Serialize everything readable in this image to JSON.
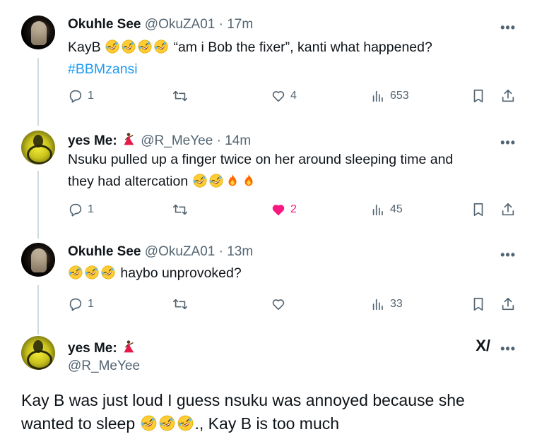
{
  "tweets": [
    {
      "name": "Okuhle See",
      "handle": "@OkuZA01",
      "time": "17m",
      "text_prefix": "KayB",
      "text_suffix": " “am i Bob the fixer”, kanti what happened?",
      "hashtag": "#BBMzansi",
      "replies": "1",
      "retweets": "",
      "likes": "4",
      "views": "653"
    },
    {
      "name": "yes Me:",
      "handle": "@R_MeYee",
      "time": "14m",
      "text_line1": "Nsuku pulled up a finger twice on her around sleeping time and",
      "text_line2": "they had altercation",
      "replies": "1",
      "likes": "2",
      "views": "45"
    },
    {
      "name": "Okuhle See",
      "handle": "@OkuZA01",
      "time": "13m",
      "text_suffix": " haybo unprovoked?",
      "replies": "1",
      "likes": "",
      "views": "33"
    }
  ],
  "main_tweet": {
    "name": "yes Me:",
    "handle": "@R_MeYee",
    "line1": "Kay B was just loud I guess nsuku was annoyed because she",
    "line2_prefix": "wanted to sleep",
    "line2_suffix": "., Kay B is too much"
  },
  "dot": "·",
  "more_label": "•••",
  "grok_label": "X/",
  "colors": {
    "link": "#1d9bf0",
    "like_active": "#f91880",
    "secondary": "#536471"
  },
  "icons": [
    "reply-icon",
    "retweet-icon",
    "like-icon",
    "views-icon",
    "bookmark-icon",
    "share-icon",
    "grok-icon",
    "more-icon",
    "rofl-emoji",
    "fire-emoji",
    "dancer-emoji"
  ]
}
